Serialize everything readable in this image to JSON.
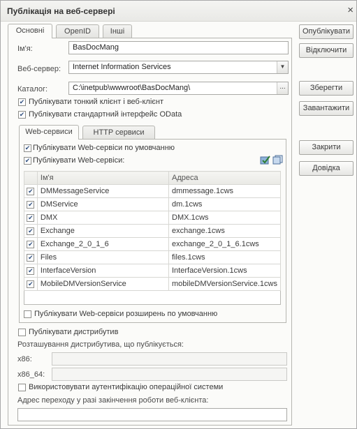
{
  "window": {
    "title": "Публікація на веб-сервері",
    "close": "×"
  },
  "tabs": [
    "Основні",
    "OpenID",
    "Інші"
  ],
  "name": {
    "label": "Ім'я:",
    "value": "BasDocMang"
  },
  "webserver": {
    "label": "Веб-сервер:",
    "value": "Internet Information Services"
  },
  "catalog": {
    "label": "Каталог:",
    "value": "C:\\inetpub\\wwwroot\\BasDocMang\\",
    "browse": "..."
  },
  "checks": {
    "thin_client": "Публікувати тонкий клієнт і веб-клієнт",
    "odata": "Публікувати стандартний інтерфейс OData"
  },
  "inner_tabs": [
    "Web-сервиси",
    "HTTP сервиси"
  ],
  "ws": {
    "default": "Публікувати Web-сервіси по умовчанню",
    "publish": "Публікувати Web-сервіси:",
    "columns": [
      "Ім'я",
      "Адреса"
    ],
    "rows": [
      [
        "DMMessageService",
        "dmmessage.1cws"
      ],
      [
        "DMService",
        "dm.1cws"
      ],
      [
        "DMX",
        "DMX.1cws"
      ],
      [
        "Exchange",
        "exchange.1cws"
      ],
      [
        "Exchange_2_0_1_6",
        "exchange_2_0_1_6.1cws"
      ],
      [
        "Files",
        "files.1cws"
      ],
      [
        "InterfaceVersion",
        "InterfaceVersion.1cws"
      ],
      [
        "MobileDMVersionService",
        "mobileDMVersionService.1cws"
      ]
    ],
    "extensions": "Публікувати Web-сервіси розширень по умовчанню"
  },
  "distrib": {
    "publish": "Публікувати дистрибутив",
    "location": "Розташування дистрибутива, що публікується:",
    "x86": "x86:",
    "x86_64": "x86_64:"
  },
  "os_auth": "Використовувати аутентифікацію операційної системи",
  "exit_url": "Адрес переходу у разі закінчення роботи веб-клієнта:",
  "buttons": {
    "publish": "Опублікувати",
    "disable": "Відключити",
    "save": "Зберегти",
    "load": "Завантажити",
    "close": "Закрити",
    "help": "Довідка"
  }
}
